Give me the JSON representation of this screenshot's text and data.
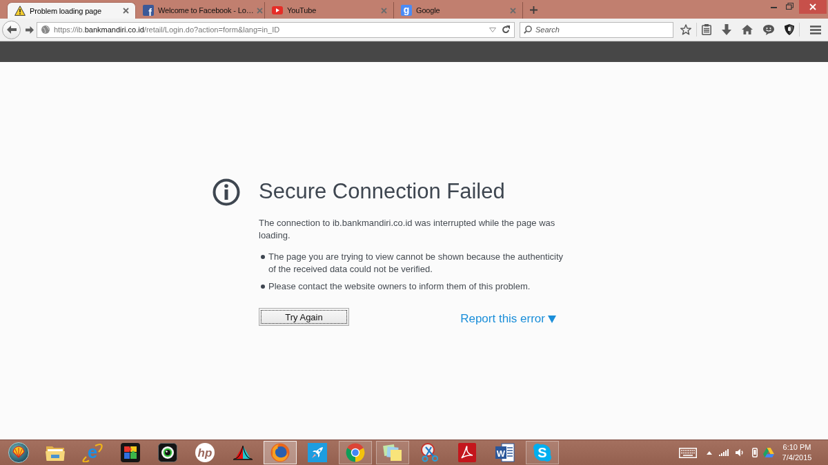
{
  "tabs": [
    {
      "kind": "warning",
      "title": "Problem loading page",
      "selected": true
    },
    {
      "kind": "fbox",
      "glyph": "f",
      "title": "Welcome to Facebook - Lo…",
      "selected": false
    },
    {
      "kind": "play",
      "title": "YouTube",
      "selected": false
    },
    {
      "kind": "gbox",
      "glyph": "g",
      "title": "Google",
      "selected": false
    }
  ],
  "navigation": {
    "url": "https://ib.**bankmandiri.co.id**/retail/Login.do?action=form&lang=in_ID",
    "search": {
      "placeholder": "Search"
    }
  },
  "error_page": {
    "title": "Secure Connection Failed",
    "message": "The connection to ib.bankmandiri.co.id was interrupted while the page was loading.",
    "bullets": [
      "The page you are trying to view cannot be shown because the authenticity of the received data could not be verified.",
      "Please contact the website owners to inform them of this problem."
    ],
    "button": "Try Again",
    "report_link": "Report this error"
  },
  "taskbar": {
    "items": [
      {
        "kind": "folder",
        "running": false,
        "selected": false
      },
      {
        "kind": "ie",
        "glyph": "e",
        "running": false,
        "selected": false
      },
      {
        "kind": "puzzle",
        "running": false,
        "selected": false
      },
      {
        "kind": "webcam",
        "running": false,
        "selected": false
      },
      {
        "kind": "hp",
        "glyph": "hp",
        "running": false,
        "selected": false
      },
      {
        "kind": "curve",
        "running": false,
        "selected": false
      },
      {
        "kind": "firefox",
        "running": true,
        "selected": true
      },
      {
        "kind": "rocket",
        "running": false,
        "selected": false
      },
      {
        "kind": "chrome",
        "running": true,
        "selected": false
      },
      {
        "kind": "notes",
        "running": true,
        "selected": false
      },
      {
        "kind": "snip",
        "running": false,
        "selected": false
      },
      {
        "kind": "acrobat",
        "running": false,
        "selected": false
      },
      {
        "kind": "word",
        "glyph": "W",
        "running": false,
        "selected": false
      },
      {
        "kind": "skype",
        "glyph": "S",
        "running": true,
        "selected": false
      }
    ],
    "clock": {
      "time": "6:10 PM",
      "date": "7/4/2015"
    }
  }
}
